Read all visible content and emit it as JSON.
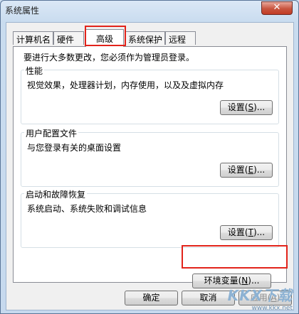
{
  "window": {
    "title": "系统属性",
    "close_glyph": "✕"
  },
  "tabs": [
    {
      "label": "计算机名"
    },
    {
      "label": "硬件"
    },
    {
      "label": "高级",
      "active": true
    },
    {
      "label": "系统保护"
    },
    {
      "label": "远程"
    }
  ],
  "intro_text": "要进行大多数更改，您必须作为管理员登录。",
  "groups": {
    "performance": {
      "title": "性能",
      "desc": "视觉效果，处理器计划，内存使用，以及及虚拟内存",
      "button": "设置",
      "mnemonic": "S"
    },
    "profiles": {
      "title": "用户配置文件",
      "desc": "与您登录有关的桌面设置",
      "button": "设置",
      "mnemonic": "E"
    },
    "startup": {
      "title": "启动和故障恢复",
      "desc": "系统启动、系统失败和调试信息",
      "button": "设置",
      "mnemonic": "T"
    }
  },
  "env_button": {
    "label": "环境变量",
    "mnemonic": "N"
  },
  "footer": {
    "ok": "确定",
    "cancel": "取消",
    "apply": "应用",
    "apply_mnemonic": "A"
  },
  "watermark": {
    "logo": "KKX下载",
    "url": "www.kkx.net"
  },
  "colors": {
    "highlight": "#e2231a",
    "close_button": "#c8553f"
  }
}
